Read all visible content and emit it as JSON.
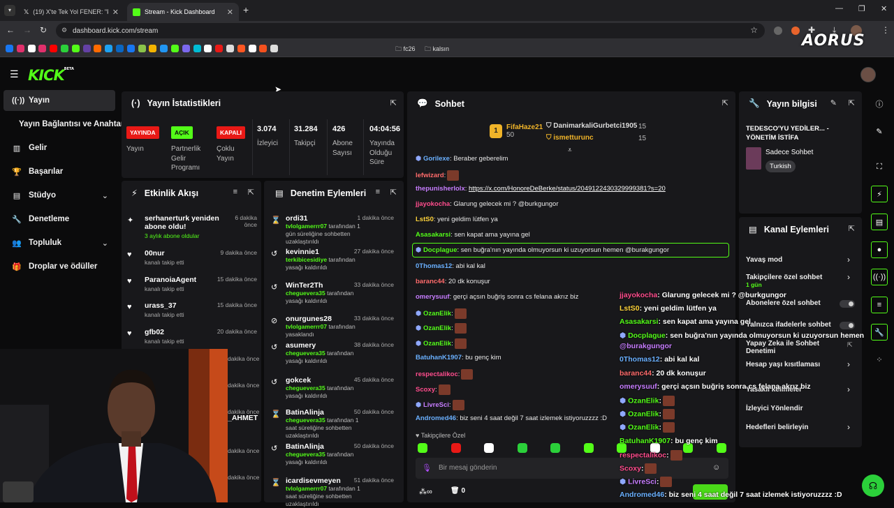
{
  "browser": {
    "tabs": [
      {
        "title": "(19) X'te Tek Yol FENER: \"Fener'i"
      },
      {
        "title": "Stream - Kick Dashboard"
      }
    ],
    "url": "dashboard.kick.com/stream",
    "bookmarks": [
      {
        "label": "fc26"
      },
      {
        "label": "kalsın"
      }
    ]
  },
  "watermark": "AORUS",
  "app": {
    "logo": "KICK",
    "logo_sup": "BETA"
  },
  "sidebar": {
    "items": [
      {
        "label": "Yayın",
        "icon": "broadcast-icon"
      },
      {
        "label": "Yayın Bağlantısı ve Anahtarı",
        "icon": ""
      },
      {
        "label": "Gelir",
        "icon": "chart-icon"
      },
      {
        "label": "Başarılar",
        "icon": "trophy-icon"
      },
      {
        "label": "Stüdyo",
        "icon": "studio-icon"
      },
      {
        "label": "Denetleme",
        "icon": "wrench-icon"
      },
      {
        "label": "Topluluk",
        "icon": "people-icon"
      },
      {
        "label": "Droplar ve ödüller",
        "icon": "gift-icon"
      }
    ]
  },
  "stats": {
    "title": "Yayın İstatistikleri",
    "badges": [
      {
        "text": "YAYINDA",
        "label_lines": [
          "Yayın"
        ],
        "color": "#e91916"
      },
      {
        "text": "AÇIK",
        "label_lines": [
          "Partnerlik",
          "Gelir",
          "Programı"
        ],
        "color": "#53fc18"
      },
      {
        "text": "KAPALI",
        "label_lines": [
          "Çoklu",
          "Yayın"
        ],
        "color": "#e91916"
      }
    ],
    "values": [
      {
        "value": "3.074",
        "label_lines": [
          "İzleyici"
        ]
      },
      {
        "value": "31.284",
        "label_lines": [
          "Takipçi"
        ]
      },
      {
        "value": "426",
        "label_lines": [
          "Abone",
          "Sayısı"
        ]
      },
      {
        "value": "04:04:56",
        "label_lines": [
          "Yayında",
          "Olduğu",
          "Süre"
        ]
      }
    ]
  },
  "activity": {
    "title": "Etkinlik Akışı",
    "items": [
      {
        "name": "serhanerturk yeniden abone oldu!",
        "sub": "3 aylık abone oldular",
        "time": "6 dakika önce",
        "icon": "sparkle-icon"
      },
      {
        "name": "00nur",
        "sub": "kanalı takip etti",
        "time": "9 dakika önce",
        "icon": "heart-icon"
      },
      {
        "name": "ParanoiaAgent",
        "sub": "kanalı takip etti",
        "time": "15 dakika önce",
        "icon": "heart-icon"
      },
      {
        "name": "urass_37",
        "sub": "kanalı takip etti",
        "time": "15 dakika önce",
        "icon": "heart-icon"
      },
      {
        "name": "gfb02",
        "sub": "kanalı takip etti",
        "time": "20 dakika önce",
        "icon": "heart-icon"
      }
    ],
    "partial": [
      {
        "time": "dakika önce"
      },
      {
        "time": "dakika önce"
      },
      {
        "time": "dakika önce"
      },
      {
        "name": "_AHMET"
      },
      {
        "time": "dakika önce"
      },
      {
        "time": "dakika önce"
      }
    ]
  },
  "moderation": {
    "title": "Denetim Eylemleri",
    "items": [
      {
        "name": "ordi31",
        "mod": "tvlolgamerrr07",
        "rest": "tarafından 1 gün süreliğine sohbetten uzaklaştırıldı",
        "time": "1 dakika önce",
        "icon": "hourglass-icon"
      },
      {
        "name": "kevinnie1",
        "mod": "terkibicesidiye",
        "rest": "tarafından yasağı kaldırıldı",
        "time": "27 dakika önce",
        "icon": "undo-icon"
      },
      {
        "name": "WinTer2Th",
        "mod": "cheguevera35",
        "rest": "tarafından yasağı kaldırıldı",
        "time": "33 dakika önce",
        "icon": "undo-icon"
      },
      {
        "name": "onurgunes28",
        "mod": "tvlolgamerrr07",
        "rest": "tarafından yasaklandı",
        "time": "33 dakika önce",
        "icon": "ban-icon"
      },
      {
        "name": "asumery",
        "mod": "cheguevera35",
        "rest": "tarafından yasağı kaldırıldı",
        "time": "38 dakika önce",
        "icon": "undo-icon"
      },
      {
        "name": "gokcek",
        "mod": "cheguevera35",
        "rest": "tarafından yasağı kaldırıldı",
        "time": "45 dakika önce",
        "icon": "undo-icon"
      },
      {
        "name": "BatinAlinja",
        "mod": "cheguevera35",
        "rest": "tarafından 1 saat süreliğine sohbetten uzaklaştırıldı",
        "time": "50 dakika önce",
        "icon": "hourglass-icon"
      },
      {
        "name": "BatinAlinja",
        "mod": "cheguevera35",
        "rest": "tarafından yasağı kaldırıldı",
        "time": "50 dakika önce",
        "icon": "undo-icon"
      },
      {
        "name": "icardisevmeyen",
        "mod": "tvlolgamerrr07",
        "rest": "tarafından 1 saat süreliğine sohbetten uzaklaştırıldı",
        "time": "51 dakika önce",
        "icon": "hourglass-icon"
      }
    ]
  },
  "chat": {
    "title": "Sohbet",
    "top_gifters": [
      {
        "rank": "1",
        "name": "FifaHaze21",
        "count": "50"
      },
      {
        "name": "DanimarkaliGurbetci1905",
        "count": "15"
      },
      {
        "name": "ismetturunc",
        "count": "15"
      }
    ],
    "messages": [
      {
        "user": "Gorilexe",
        "text": ": Beraber geberelim",
        "color": "#6ab0ff"
      },
      {
        "user": "lefwizard",
        "text": ":",
        "color": "#ff6b6b"
      },
      {
        "user": "thepunisherlolx",
        "text": ":",
        "link": "https://x.com/HonoreDeBerke/status/2049122430329999381?s=20",
        "color": "#c77dff"
      },
      {
        "user": "jjayokocha",
        "text": ": Glarung gelecek mi ? @burkgungor",
        "color": "#ff4d8d"
      },
      {
        "user": "LstS0",
        "text": ": yeni geldim lütfen ya",
        "color": "#ffd43b"
      },
      {
        "user": "Asasakarsi",
        "text": ": sen kapat ama yayına gel",
        "color": "#53fc18"
      },
      {
        "user": "Docplague",
        "text": ": sen buğra'nın yayında olmuyorsun ki uzuyorsun hemen @burakgungor",
        "color": "#53fc18"
      },
      {
        "user": "0Thomas12",
        "text": ": abi kal kal",
        "color": "#6ab0ff"
      },
      {
        "user": "baranc44",
        "text": ": 20 dk konuşur",
        "color": "#ff6b6b"
      },
      {
        "user": "omerysuuf",
        "text": ": gerçi açsın buğriş sonra cs felana akrız biz",
        "color": "#c77dff"
      },
      {
        "user": "OzanElik",
        "text": ":",
        "color": "#53fc18"
      },
      {
        "user": "OzanElik",
        "text": ":",
        "color": "#53fc18"
      },
      {
        "user": "OzanElik",
        "text": ":",
        "color": "#53fc18"
      },
      {
        "user": "BatuhanK1907",
        "text": ": bu genç kim",
        "color": "#6ab0ff"
      },
      {
        "user": "respectalikoc",
        "text": ":",
        "color": "#ff4d8d"
      },
      {
        "user": "Scoxy",
        "text": ":",
        "color": "#ff4d8d"
      },
      {
        "user": "LivreSci",
        "text": ":",
        "color": "#c77dff"
      },
      {
        "user": "Andromed46",
        "text": ": biz seni 4 saat değil 7 saat izlemek istiyoruzzzz :D",
        "color": "#6ab0ff"
      }
    ],
    "followers_only": "Takipçilere Özel",
    "input_placeholder": "Bir mesaj gönderin",
    "footer_count": "0"
  },
  "overlay_chat": [
    {
      "user": "jjayokocha",
      "text": ": Glarung gelecek mi ? @burkgungor",
      "color": "#ff4d8d"
    },
    {
      "user": "LstS0",
      "text": ": yeni geldim lütfen ya",
      "color": "#ffd43b"
    },
    {
      "user": "Asasakarsi",
      "text": ": sen kapat ama yayına gel",
      "color": "#53fc18"
    },
    {
      "user": "Docplague",
      "text": ": sen buğra'nın yayında olmuyorsun ki uzuyorsun hemen",
      "color": "#53fc18"
    },
    {
      "user": "",
      "text": "@burakgungor",
      "color": "#c77dff"
    },
    {
      "user": "0Thomas12",
      "text": ": abi kal kal",
      "color": "#6ab0ff"
    },
    {
      "user": "baranc44",
      "text": ": 20 dk konuşur",
      "color": "#ff6b6b"
    },
    {
      "user": "omerysuuf",
      "text": ": gerçi açsın buğriş sonra cs felana akrız biz",
      "color": "#c77dff"
    },
    {
      "user": "OzanElik",
      "text": ":",
      "color": "#53fc18"
    },
    {
      "user": "OzanElik",
      "text": ":",
      "color": "#53fc18"
    },
    {
      "user": "OzanElik",
      "text": ":",
      "color": "#53fc18"
    },
    {
      "user": "BatuhanK1907",
      "text": ": bu genç kim",
      "color": "#53fc18"
    },
    {
      "user": "respectalikoc",
      "text": ":",
      "color": "#ff4d8d"
    },
    {
      "user": "Scoxy",
      "text": ":",
      "color": "#ff4d8d"
    },
    {
      "user": "LivreSci",
      "text": ":",
      "color": "#c77dff"
    },
    {
      "user": "Andromed46",
      "text": ": biz seni 4 saat değil 7 saat izlemek istiyoruzzzz :D",
      "color": "#6ab0ff"
    }
  ],
  "stream_info": {
    "title": "Yayın bilgisi",
    "stream_title": "TEDESCO'YU YEDİLER... - YÖNETİM İSTİFA",
    "category": "Sadece Sohbet",
    "tag": "Turkish"
  },
  "channel_actions": {
    "title": "Kanal Eylemleri",
    "items": [
      {
        "label": "Yavaş mod",
        "sub": "",
        "kind": "chevron"
      },
      {
        "label": "Takipçilere özel sohbet",
        "sub": "1 gün",
        "kind": "chevron"
      },
      {
        "label": "Abonelere özel sohbet",
        "sub": "",
        "kind": "toggle"
      },
      {
        "label": "Yalnızca ifadelerle sohbet",
        "sub": "",
        "kind": "toggle"
      },
      {
        "label": "Yapay Zeka ile Sohbet Denetimi",
        "sub": "",
        "kind": "external"
      },
      {
        "label": "Hesap yaşı kısıtlaması",
        "sub": "",
        "kind": "chevron"
      },
      {
        "label": "Yasaklı kelimeler",
        "sub": "",
        "kind": "chevron"
      },
      {
        "label": "İzleyici Yönlendir",
        "sub": "",
        "kind": "none"
      },
      {
        "label": "Hedefleri belirleyin",
        "sub": "",
        "kind": "chevron"
      }
    ]
  },
  "colors": {
    "accent": "#53fc18",
    "live": "#e91916",
    "panel": "#18181b"
  }
}
